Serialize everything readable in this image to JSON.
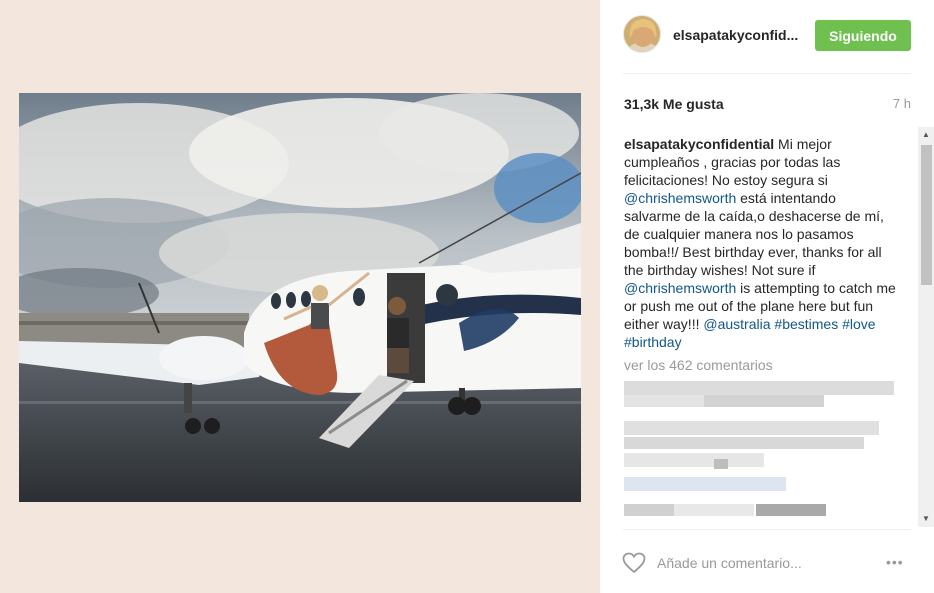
{
  "post": {
    "image_alt": "Jet photo",
    "user": {
      "username": "elsapatakyconfid...",
      "follow_label": "Siguiendo"
    },
    "likes": "31,3k Me gusta",
    "time_ago": "7 h",
    "caption": {
      "username": "elsapatakyconfidential",
      "text_part1": " Mi mejor cumpleaños , gracias por todas las felicitaciones! No estoy segura si ",
      "mention1": "@chrishemsworth",
      "text_part2": " está intentando salvarme de la caída,o deshacerse de mí, de cualquier manera nos lo pasamos bomba!!/ Best birthday ever, thanks for all the birthday wishes! Not sure if ",
      "mention2": "@chrishemsworth",
      "text_part3": " is attempting to catch me or push me out of the plane here but fun either way!!! ",
      "tag1": "@australia",
      "tag2": "#bestimes",
      "tag3": "#love",
      "tag4": "#birthday"
    },
    "load_more": "ver los 462 comentarios",
    "comment_placeholder": "Añade un comentario...",
    "more_options": "•••"
  },
  "icons": {
    "heart": "heart-icon",
    "scroll_up": "triangle-up-icon",
    "scroll_down": "triangle-down-icon"
  },
  "colors": {
    "follow_green": "#70c050",
    "link_blue": "#125688",
    "page_bg": "#f3e6dc"
  }
}
